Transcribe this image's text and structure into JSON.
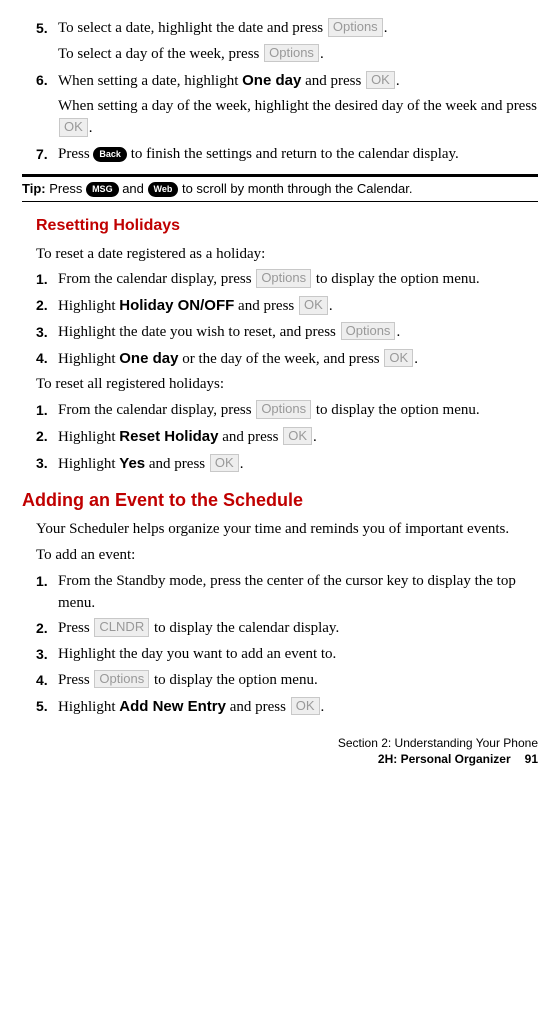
{
  "buttons": {
    "options": "Options",
    "ok": "OK",
    "clndr": "CLNDR",
    "back": "Back",
    "msg": "MSG",
    "web": "Web"
  },
  "top": {
    "s5a": "To select a date, highlight the date and press ",
    "s5b": ".",
    "s5c1": "To select a day of the week, press ",
    "s5c2": ".",
    "s6a": "When setting a date, highlight ",
    "s6bold": "One day",
    "s6b": " and press ",
    "s6c": ".",
    "s6d1": "When setting a day of the week, highlight the desired day of the week and press ",
    "s6d2": ".",
    "s7a": "Press ",
    "s7b": " to finish the settings and return to the calendar display."
  },
  "tip": {
    "label": "Tip:",
    "a": " Press ",
    "b": " and ",
    "c": " to scroll by month through the Calendar."
  },
  "reset": {
    "heading": "Resetting Holidays",
    "intro": "To reset a date registered as a holiday:",
    "s1a": "From the calendar display, press ",
    "s1b": " to display the option menu.",
    "s2a": "Highlight ",
    "s2bold": "Holiday ON/OFF",
    "s2b": " and press ",
    "s2c": ".",
    "s3a": "Highlight the date you wish to reset, and press ",
    "s3b": ".",
    "s4a": "Highlight ",
    "s4bold": "One day",
    "s4b": " or the day of the week, and press ",
    "s4c": ".",
    "intro2": "To reset all registered holidays:",
    "r1a": "From the calendar display, press ",
    "r1b": " to display the option menu.",
    "r2a": "Highlight ",
    "r2bold": "Reset Holiday",
    "r2b": " and press ",
    "r2c": ".",
    "r3a": "Highlight ",
    "r3bold": "Yes",
    "r3b": " and press ",
    "r3c": "."
  },
  "add": {
    "heading": "Adding an Event to the Schedule",
    "intro1": "Your Scheduler helps organize your time and reminds you of important events.",
    "intro2": "To add an event:",
    "s1": "From the Standby mode, press the center of the cursor key to display the top menu.",
    "s2a": "Press ",
    "s2b": " to display the calendar display.",
    "s3": "Highlight the day you want to add an event to.",
    "s4a": "Press ",
    "s4b": " to display the option menu.",
    "s5a": "Highlight ",
    "s5bold": "Add New Entry",
    "s5b": " and press ",
    "s5c": "."
  },
  "footer": {
    "line1": "Section 2: Understanding Your Phone",
    "line2": "2H: Personal Organizer",
    "page": "91"
  }
}
